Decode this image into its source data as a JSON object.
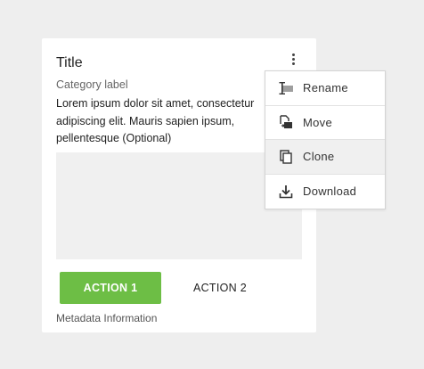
{
  "card": {
    "title": "Title",
    "category": "Category label",
    "body_lines": [
      "Lorem ipsum dolor sit amet, consectetur",
      "adipiscing elit. Mauris sapien ipsum,",
      "pellentesque (Optional)"
    ],
    "action1_label": "ACTION 1",
    "action2_label": "ACTION 2",
    "metadata": "Metadata Information"
  },
  "menu": {
    "items": [
      {
        "label": "Rename",
        "icon": "rename-icon"
      },
      {
        "label": "Move",
        "icon": "move-icon"
      },
      {
        "label": "Clone",
        "icon": "clone-icon"
      },
      {
        "label": "Download",
        "icon": "download-icon"
      }
    ],
    "hovered_index": 2
  },
  "colors": {
    "accent": "#6dbe45",
    "background": "#eeeeee"
  }
}
